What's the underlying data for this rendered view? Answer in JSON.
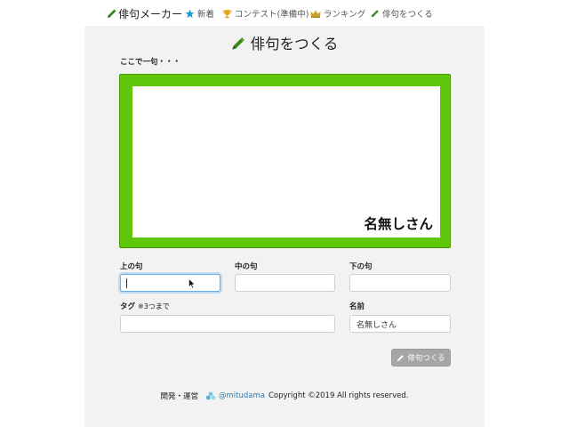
{
  "navbar": {
    "brand": "俳句メーカー",
    "items": [
      {
        "label": "新着",
        "icon": "star-icon"
      },
      {
        "label": "コンテスト(準備中)",
        "icon": "trophy-icon"
      },
      {
        "label": "ランキング",
        "icon": "crown-icon"
      },
      {
        "label": "俳句をつくる",
        "icon": "pencil-icon"
      }
    ]
  },
  "main": {
    "title": "俳句をつくる",
    "preview_label": "ここで一句・・・",
    "preview_author": "名無しさん"
  },
  "form": {
    "kami_label": "上の句",
    "naka_label": "中の句",
    "shimo_label": "下の句",
    "kami_value": "",
    "naka_value": "",
    "shimo_value": "",
    "tag_label": "タグ",
    "tag_note": "※3つまで",
    "tag_value": "",
    "name_label": "名前",
    "name_value": "名無しさん",
    "submit_label": "俳句つくる"
  },
  "footer": {
    "prefix": "開発・運営",
    "handle": "@mitudama",
    "copyright": "Copyright ©2019 All rights reserved."
  },
  "colors": {
    "preview_frame": "#5fc60a",
    "brand_pencil": "#3a8a1a",
    "star": "#1a9ad6",
    "trophy": "#e8a317",
    "crown": "#c9a227",
    "link": "#2a7ab8",
    "submit_button": "#a6a6a6"
  }
}
